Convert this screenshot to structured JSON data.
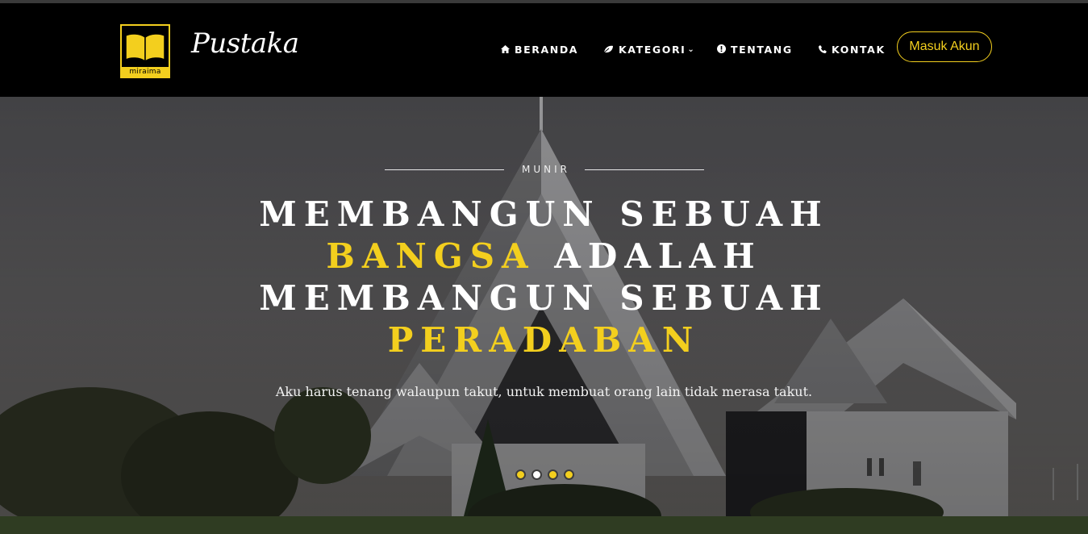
{
  "brand": {
    "logo_caption": "miraima",
    "name": "Pustaka"
  },
  "nav": {
    "items": [
      {
        "label": "BERANDA",
        "icon": "home-icon"
      },
      {
        "label": "KATEGORI",
        "icon": "leaf-icon",
        "has_dropdown": true
      },
      {
        "label": "TENTANG",
        "icon": "info-icon"
      },
      {
        "label": "KONTAK",
        "icon": "phone-icon"
      }
    ],
    "login_label": "Masuk Akun"
  },
  "hero": {
    "kicker": "MUNIR",
    "headline": {
      "line1": "MEMBANGUN SEBUAH",
      "line2_highlight": "BANGSA",
      "line2_rest": "ADALAH",
      "line3": "MEMBANGUN SEBUAH",
      "line4_highlight": "PERADABAN"
    },
    "subtitle": "Aku harus tenang walaupun takut, untuk membuat orang lain tidak merasa takut.",
    "slides": 4,
    "active_slide": 2
  },
  "colors": {
    "accent": "#f3cf1e",
    "navbar_bg": "#000000",
    "text": "#ffffff"
  }
}
